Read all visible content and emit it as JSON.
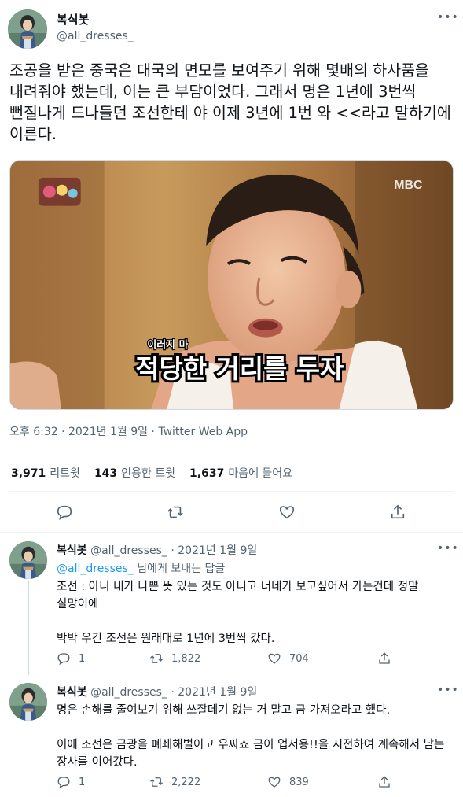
{
  "tweet": {
    "display_name": "복식봇",
    "handle": "@all_dresses_",
    "text": "조공을 받은 중국은 대국의 면모를 보여주기 위해 몇배의 하사품을 내려줘야 했는데, 이는 큰 부담이었다. 그래서 명은 1년에 3번씩 뻔질나게 드나들던 조선한테 야 이제 3년에 1번 와 <<라고 말하기에 이른다.",
    "media": {
      "watermark": "MBC",
      "caption_small": "이러지 마",
      "caption_big": "적당한 거리를 두자"
    },
    "timestamp": "오후 6:32 · 2021년 1월 9일 · Twitter Web App",
    "stats": [
      {
        "count": "3,971",
        "label": "리트윗"
      },
      {
        "count": "143",
        "label": "인용한 트윗"
      },
      {
        "count": "1,637",
        "label": "마음에 들어요"
      }
    ]
  },
  "icons": {
    "more": "more-icon",
    "reply": "reply-icon",
    "retweet": "retweet-icon",
    "like": "heart-icon",
    "share": "share-icon"
  },
  "replies": [
    {
      "display_name": "복식봇",
      "handle": "@all_dresses_",
      "date": "2021년 1월 9일",
      "replying_to": "@all_dresses_",
      "replying_suffix": " 님에게 보내는 답글",
      "paragraphs": [
        "조선 : 아니 내가 나쁜 뜻 있는 것도 아니고 너네가 보고싶어서 가는건데 정말 실망이에",
        "박박 우긴 조선은 원래대로 1년에 3번씩 갔다."
      ],
      "reply_count": "1",
      "retweet_count": "1,822",
      "like_count": "704"
    },
    {
      "display_name": "복식봇",
      "handle": "@all_dresses_",
      "date": "2021년 1월 9일",
      "paragraphs": [
        "명은 손해를 줄여보기 위해 쓰잘데기 없는 거 말고 금 가져오라고 했다.",
        "이에 조선은 금광을 폐쇄해벌이고 우짜죠 금이 업서용!!을 시전하여 계속해서 남는 장사를 이어갔다."
      ],
      "reply_count": "1",
      "retweet_count": "2,222",
      "like_count": "839"
    }
  ],
  "colors": {
    "text": "#0f1419",
    "secondary": "#536471",
    "link": "#1d9bf0",
    "divider": "#eff3f4"
  }
}
